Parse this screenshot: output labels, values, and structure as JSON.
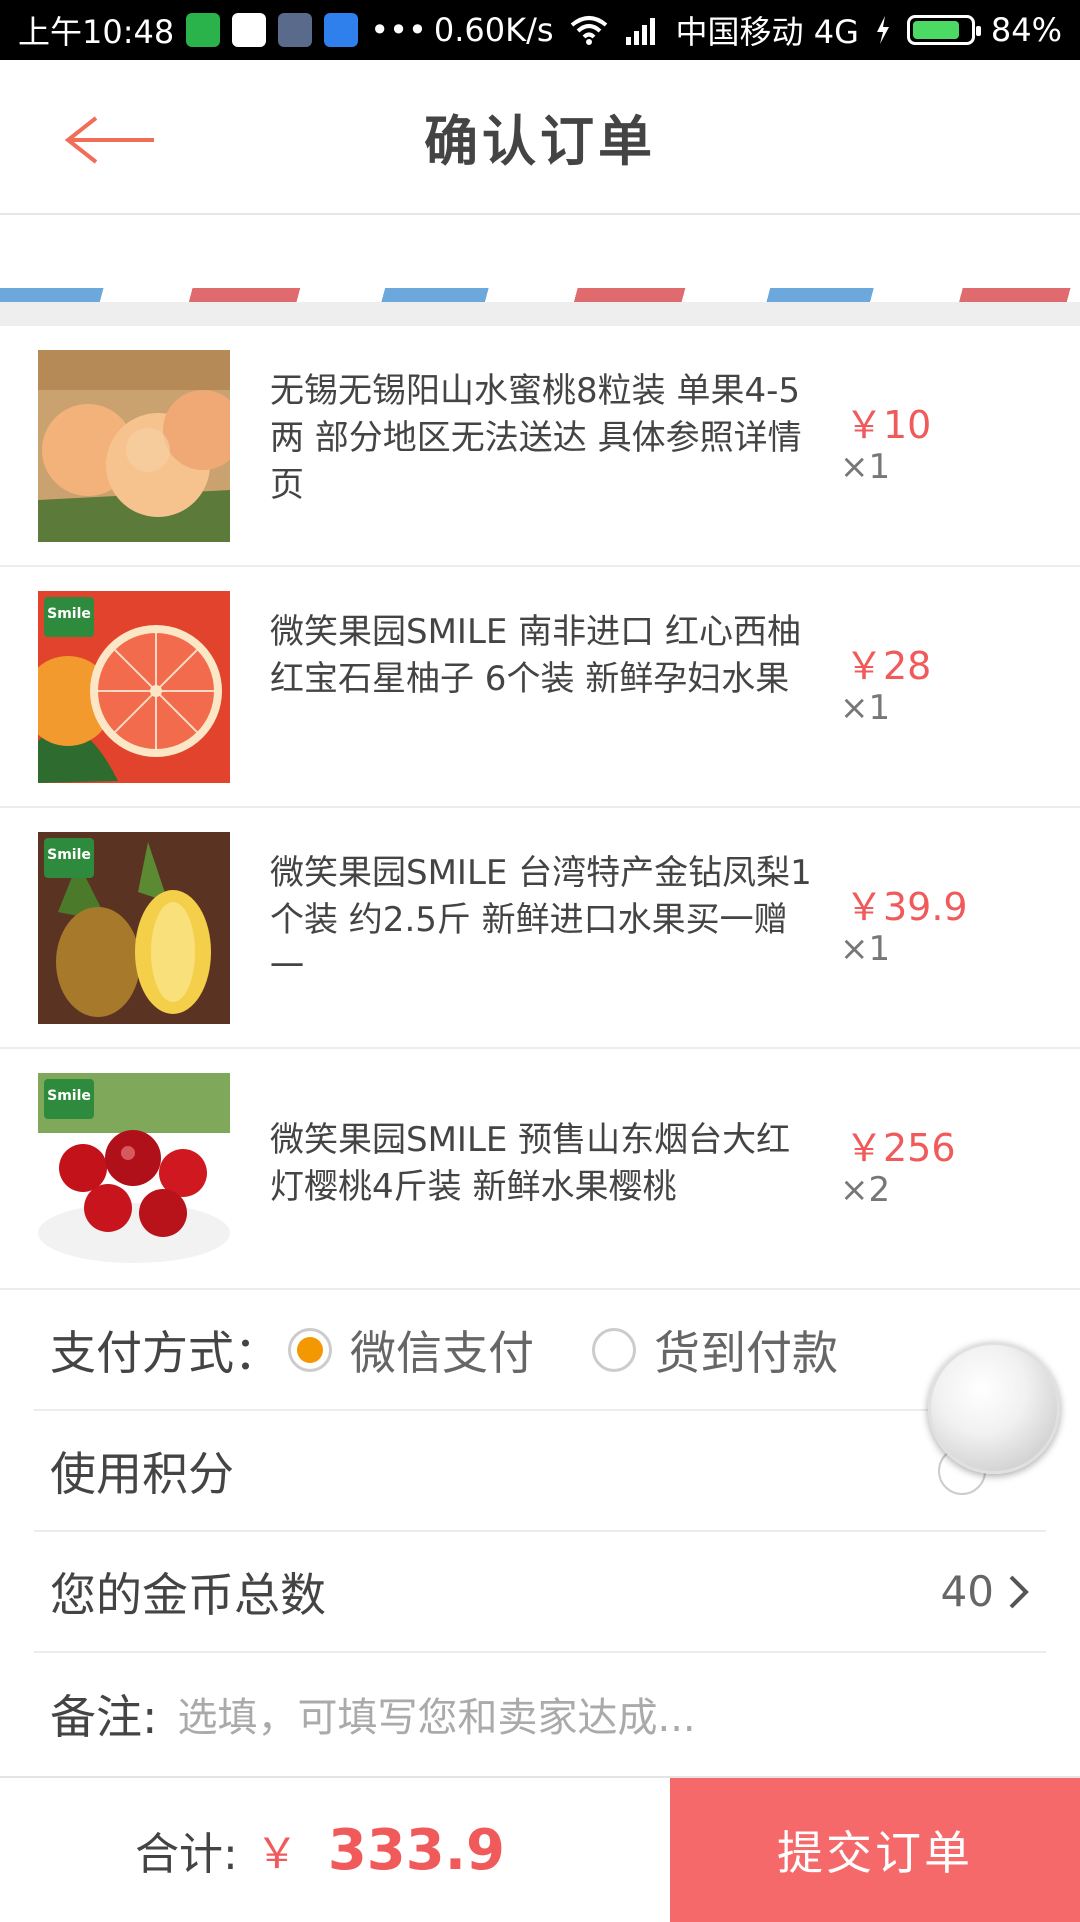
{
  "status_bar": {
    "time": "上午10:48",
    "net_speed": "0.60K/s",
    "carrier": "中国移动 4G",
    "battery": "84%",
    "battery_level": 0.84
  },
  "header": {
    "title": "确认订单"
  },
  "items": [
    {
      "name": "无锡无锡阳山水蜜桃8粒装 单果4-5两 部分地区无法送达 具体参照详情页",
      "price": "￥10",
      "qty": "×1",
      "image": "peach-image"
    },
    {
      "name": "微笑果园SMILE 南非进口 红心西柚 红宝石星柚子 6个装 新鲜孕妇水果",
      "price": "￥28",
      "qty": "×1",
      "image": "grapefruit-image"
    },
    {
      "name": "微笑果园SMILE 台湾特产金钻凤梨1 个装 约2.5斤 新鲜进口水果买一赠一",
      "price": "￥39.9",
      "qty": "×1",
      "image": "pineapple-image"
    },
    {
      "name": "微笑果园SMILE 预售山东烟台大红灯樱桃4斤装 新鲜水果樱桃",
      "price": "￥256",
      "qty": "×2",
      "image": "cherry-image"
    }
  ],
  "smile_badge": "Smile",
  "payment": {
    "label": "支付方式：",
    "option1": "微信支付",
    "option2": "货到付款",
    "selected": "微信支付"
  },
  "points": {
    "label": "使用积分"
  },
  "coins": {
    "label": "您的金币总数",
    "value": "40"
  },
  "note": {
    "label": "备注:",
    "placeholder": "选填，可填写您和卖家达成..."
  },
  "footer": {
    "total_label": "合计:",
    "currency": "￥",
    "total": "333.9",
    "submit": "提交订单"
  },
  "colors": {
    "accent": "#f05a5a",
    "submit_bg": "#f6696b",
    "radio_on": "#f39800"
  }
}
